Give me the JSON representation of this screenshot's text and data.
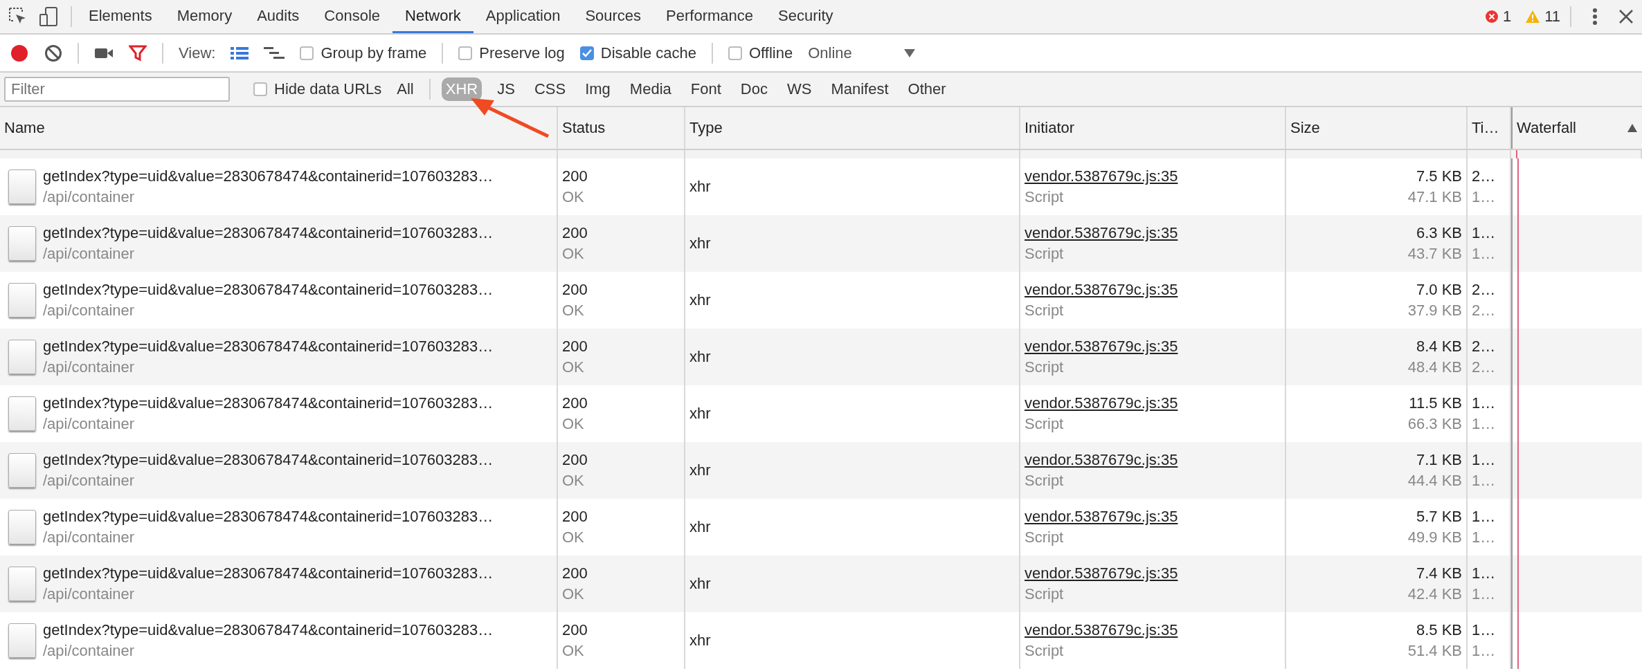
{
  "main_tabs": [
    {
      "label": "Elements",
      "selected": false
    },
    {
      "label": "Memory",
      "selected": false
    },
    {
      "label": "Audits",
      "selected": false
    },
    {
      "label": "Console",
      "selected": false
    },
    {
      "label": "Network",
      "selected": true
    },
    {
      "label": "Application",
      "selected": false
    },
    {
      "label": "Sources",
      "selected": false
    },
    {
      "label": "Performance",
      "selected": false
    },
    {
      "label": "Security",
      "selected": false
    }
  ],
  "console_counts": {
    "errors": "1",
    "warnings": "11"
  },
  "toolbar": {
    "recording": true,
    "view_label": "View:",
    "checkboxes": [
      {
        "label": "Group by frame",
        "checked": false
      },
      {
        "label": "Preserve log",
        "checked": false
      },
      {
        "label": "Disable cache",
        "checked": true
      },
      {
        "label": "Offline",
        "checked": false
      }
    ],
    "throttling": "Online"
  },
  "filter_bar": {
    "placeholder": "Filter",
    "hide_data_urls": {
      "label": "Hide data URLs",
      "checked": false
    },
    "types": [
      {
        "label": "All",
        "selected": false
      },
      {
        "label": "XHR",
        "selected": true
      },
      {
        "label": "JS",
        "selected": false
      },
      {
        "label": "CSS",
        "selected": false
      },
      {
        "label": "Img",
        "selected": false
      },
      {
        "label": "Media",
        "selected": false
      },
      {
        "label": "Font",
        "selected": false
      },
      {
        "label": "Doc",
        "selected": false
      },
      {
        "label": "WS",
        "selected": false
      },
      {
        "label": "Manifest",
        "selected": false
      },
      {
        "label": "Other",
        "selected": false
      }
    ]
  },
  "table": {
    "columns": [
      "Name",
      "Status",
      "Type",
      "Initiator",
      "Size",
      "Ti…",
      "Waterfall"
    ],
    "rows": [
      {
        "name": "getIndex?type=uid&value=2830678474&containerid=107603283…",
        "path": "/api/container",
        "status": "200",
        "status_text": "OK",
        "type": "xhr",
        "initiator": "vendor.5387679c.js:35",
        "initiator_type": "Script",
        "size": "7.5 KB",
        "resource_size": "47.1 KB",
        "time": "2…",
        "latency": "1…"
      },
      {
        "name": "getIndex?type=uid&value=2830678474&containerid=107603283…",
        "path": "/api/container",
        "status": "200",
        "status_text": "OK",
        "type": "xhr",
        "initiator": "vendor.5387679c.js:35",
        "initiator_type": "Script",
        "size": "6.3 KB",
        "resource_size": "43.7 KB",
        "time": "1…",
        "latency": "1…"
      },
      {
        "name": "getIndex?type=uid&value=2830678474&containerid=107603283…",
        "path": "/api/container",
        "status": "200",
        "status_text": "OK",
        "type": "xhr",
        "initiator": "vendor.5387679c.js:35",
        "initiator_type": "Script",
        "size": "7.0 KB",
        "resource_size": "37.9 KB",
        "time": "2…",
        "latency": "2…"
      },
      {
        "name": "getIndex?type=uid&value=2830678474&containerid=107603283…",
        "path": "/api/container",
        "status": "200",
        "status_text": "OK",
        "type": "xhr",
        "initiator": "vendor.5387679c.js:35",
        "initiator_type": "Script",
        "size": "8.4 KB",
        "resource_size": "48.4 KB",
        "time": "2…",
        "latency": "2…"
      },
      {
        "name": "getIndex?type=uid&value=2830678474&containerid=107603283…",
        "path": "/api/container",
        "status": "200",
        "status_text": "OK",
        "type": "xhr",
        "initiator": "vendor.5387679c.js:35",
        "initiator_type": "Script",
        "size": "11.5 KB",
        "resource_size": "66.3 KB",
        "time": "1…",
        "latency": "1…"
      },
      {
        "name": "getIndex?type=uid&value=2830678474&containerid=107603283…",
        "path": "/api/container",
        "status": "200",
        "status_text": "OK",
        "type": "xhr",
        "initiator": "vendor.5387679c.js:35",
        "initiator_type": "Script",
        "size": "7.1 KB",
        "resource_size": "44.4 KB",
        "time": "1…",
        "latency": "1…"
      },
      {
        "name": "getIndex?type=uid&value=2830678474&containerid=107603283…",
        "path": "/api/container",
        "status": "200",
        "status_text": "OK",
        "type": "xhr",
        "initiator": "vendor.5387679c.js:35",
        "initiator_type": "Script",
        "size": "5.7 KB",
        "resource_size": "49.9 KB",
        "time": "1…",
        "latency": "1…"
      },
      {
        "name": "getIndex?type=uid&value=2830678474&containerid=107603283…",
        "path": "/api/container",
        "status": "200",
        "status_text": "OK",
        "type": "xhr",
        "initiator": "vendor.5387679c.js:35",
        "initiator_type": "Script",
        "size": "7.4 KB",
        "resource_size": "42.4 KB",
        "time": "1…",
        "latency": "1…"
      },
      {
        "name": "getIndex?type=uid&value=2830678474&containerid=107603283…",
        "path": "/api/container",
        "status": "200",
        "status_text": "OK",
        "type": "xhr",
        "initiator": "vendor.5387679c.js:35",
        "initiator_type": "Script",
        "size": "8.5 KB",
        "resource_size": "51.4 KB",
        "time": "1…",
        "latency": "1…"
      }
    ]
  }
}
